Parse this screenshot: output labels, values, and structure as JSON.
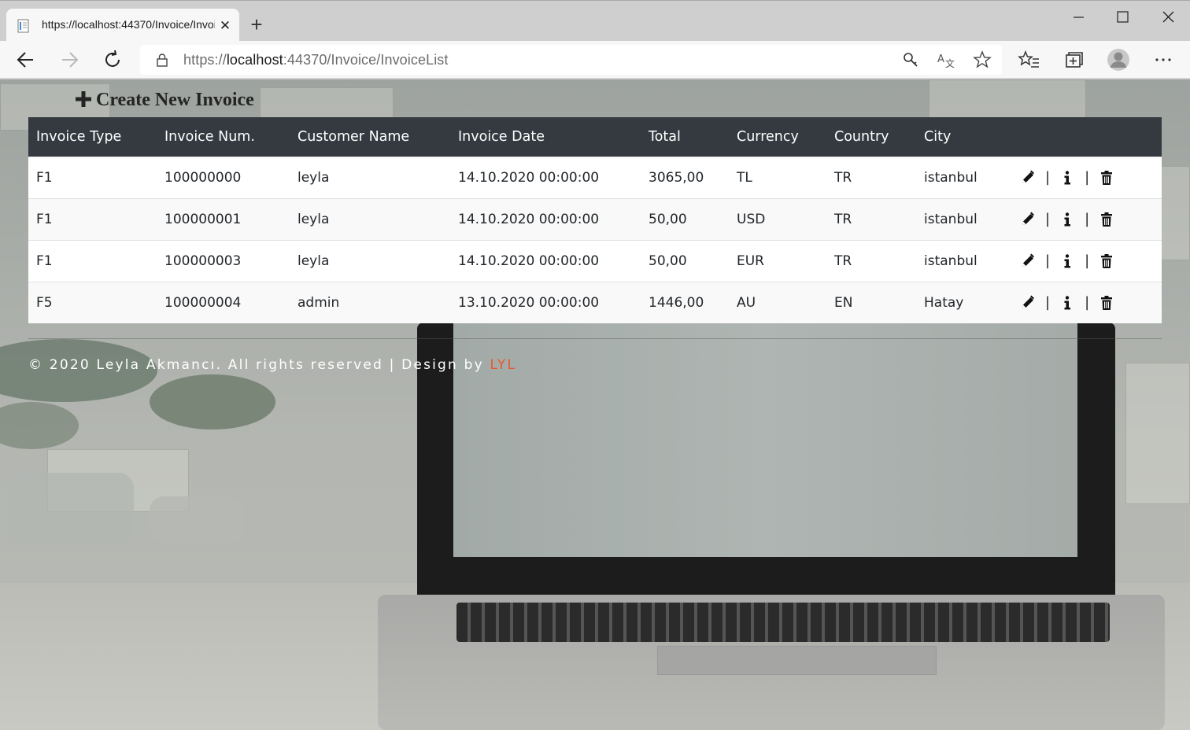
{
  "browser": {
    "tab_title": "https://localhost:44370/Invoice/InvoiceList",
    "url_prefix": "https://",
    "url_host": "localhost",
    "url_rest": ":44370/Invoice/InvoiceList"
  },
  "page": {
    "create_label": "Create New Invoice",
    "table": {
      "headers": [
        "Invoice Type",
        "Invoice Num.",
        "Customer Name",
        "Invoice Date",
        "Total",
        "Currency",
        "Country",
        "City"
      ],
      "rows": [
        [
          "F1",
          "100000000",
          "leyla",
          "14.10.2020 00:00:00",
          "3065,00",
          "TL",
          "TR",
          "istanbul"
        ],
        [
          "F1",
          "100000001",
          "leyla",
          "14.10.2020 00:00:00",
          "50,00",
          "USD",
          "TR",
          "istanbul"
        ],
        [
          "F1",
          "100000003",
          "leyla",
          "14.10.2020 00:00:00",
          "50,00",
          "EUR",
          "TR",
          "istanbul"
        ],
        [
          "F5",
          "100000004",
          "admin",
          "13.10.2020 00:00:00",
          "1446,00",
          "AU",
          "EN",
          "Hatay"
        ]
      ],
      "action_separator": "|",
      "action_icons": [
        "pencil-icon",
        "info-icon",
        "trash-icon"
      ]
    },
    "footer": {
      "text": "© 2020 Leyla Akmancı. All rights reserved | Design by ",
      "brand": "LYL",
      "brand_color": "#e8582f"
    }
  },
  "colors": {
    "table_header_bg": "#343a40",
    "table_header_text": "#ffffff"
  }
}
